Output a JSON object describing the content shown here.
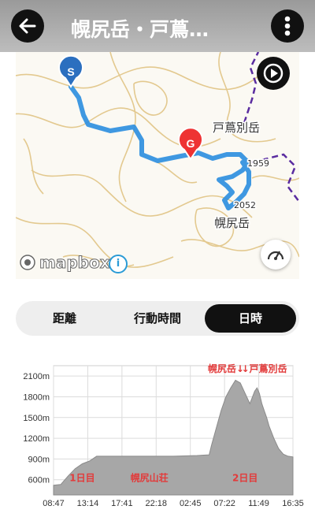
{
  "header": {
    "title": "幌尻岳・戸蔦…"
  },
  "map": {
    "labels": {
      "peak1": "戸蔦別岳",
      "peak2": "幌尻岳",
      "elev1": "1959",
      "elev2": "2052"
    },
    "markers": {
      "start": "S",
      "goal": "G"
    },
    "attribution": {
      "logo": "mapbox",
      "info": "i"
    }
  },
  "tabs": [
    {
      "label": "距離",
      "active": false
    },
    {
      "label": "行動時間",
      "active": false
    },
    {
      "label": "日時",
      "active": true
    }
  ],
  "chart_data": {
    "type": "area",
    "y_ticks": [
      "2100m",
      "1800m",
      "1500m",
      "1200m",
      "900m",
      "600m"
    ],
    "x_ticks": [
      "08:47",
      "13:14",
      "17:41",
      "22:18",
      "02:45",
      "07:22",
      "11:49",
      "16:35"
    ],
    "ylim": [
      380,
      2250
    ],
    "x": [
      0,
      0.03,
      0.06,
      0.09,
      0.12,
      0.15,
      0.18,
      0.3,
      0.4,
      0.5,
      0.6,
      0.65,
      0.66,
      0.68,
      0.7,
      0.72,
      0.74,
      0.76,
      0.78,
      0.8,
      0.82,
      0.84,
      0.85,
      0.86,
      0.87,
      0.88,
      0.89,
      0.9,
      0.92,
      0.94,
      0.96,
      0.98,
      1.0
    ],
    "y": [
      520,
      530,
      650,
      760,
      830,
      870,
      940,
      940,
      940,
      940,
      950,
      960,
      1100,
      1350,
      1600,
      1800,
      1930,
      2040,
      2000,
      1850,
      1700,
      1880,
      1930,
      1850,
      1700,
      1600,
      1500,
      1380,
      1200,
      1050,
      970,
      940,
      930
    ],
    "annotations": [
      {
        "text": "幌尻岳↓",
        "x": 0.72,
        "y": 2160
      },
      {
        "text": "↓戸蔦別岳",
        "x": 0.88,
        "y": 2160
      },
      {
        "text": "1日目",
        "x": 0.12,
        "y": 580
      },
      {
        "text": "幌尻山荘",
        "x": 0.4,
        "y": 580
      },
      {
        "text": "2日目",
        "x": 0.8,
        "y": 580
      }
    ],
    "colors": {
      "fill": "#a7a7a7",
      "annotation": "#e23b3b"
    }
  }
}
